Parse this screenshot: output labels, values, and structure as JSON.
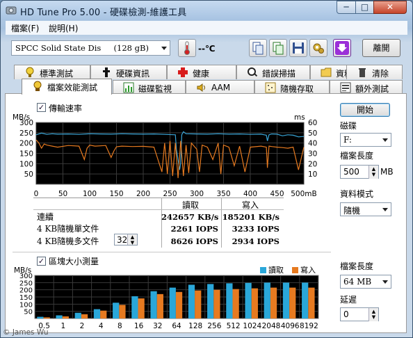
{
  "window": {
    "title": "HD Tune Pro  5.00 - 硬碟檢測-維護工具",
    "minimize": "─",
    "maximize": "□",
    "close": "✕"
  },
  "menu": {
    "items": [
      "檔案(F)",
      "說明(H)"
    ]
  },
  "toolbar": {
    "drive_select": "SPCC Solid State Dis     (128 gB)",
    "temperature": "--℃",
    "exit_label": "離開",
    "accent_purple": "#9b2fd8"
  },
  "tabs_row1": [
    {
      "label": "標準測試",
      "icon": "benchmark-icon"
    },
    {
      "label": "硬碟資訊",
      "icon": "info-icon"
    },
    {
      "label": "健康",
      "icon": "health-cross-icon"
    },
    {
      "label": "錯誤掃描",
      "icon": "error-scan-icon"
    },
    {
      "label": "資料夾使用率",
      "icon": "folder-icon"
    },
    {
      "label": "清除",
      "icon": "trash-icon"
    }
  ],
  "tabs_row2": [
    {
      "label": "檔案效能測試",
      "icon": "file-benchmark-icon",
      "active": true
    },
    {
      "label": "磁碟監視",
      "icon": "disk-monitor-icon"
    },
    {
      "label": "AAM",
      "icon": "speaker-icon"
    },
    {
      "label": "隨機存取",
      "icon": "random-access-icon"
    },
    {
      "label": "額外測試",
      "icon": "extra-tests-icon"
    }
  ],
  "transfer": {
    "checkbox_label": "傳輸速率",
    "checked": true,
    "headers": {
      "read": "讀取",
      "write": "寫入"
    },
    "rows": [
      {
        "label": "連續",
        "read": "242657 KB/s",
        "write": "185201 KB/s"
      },
      {
        "label": "4 KB隨機單文件",
        "read": "2261 IOPS",
        "write": "3233 IOPS"
      },
      {
        "label": "4 KB隨機多文件",
        "read": "8626 IOPS",
        "write": "2934 IOPS"
      }
    ],
    "queue_depth": "32"
  },
  "chart_data": [
    {
      "type": "line",
      "title": "",
      "xlabel": "",
      "ylabel": "MB/s",
      "y2label": "ms",
      "x_unit": "mB",
      "xlim": [
        0,
        500
      ],
      "ylim": [
        0,
        300
      ],
      "y2lim": [
        0,
        60
      ],
      "x_ticks": [
        "0",
        "50",
        "100",
        "150",
        "200",
        "250",
        "300",
        "350",
        "400",
        "450",
        "500mB"
      ],
      "y_ticks": [
        "300",
        "250",
        "200",
        "150",
        "100",
        "50"
      ],
      "y2_ticks": [
        "60",
        "50",
        "40",
        "30",
        "20",
        "10"
      ],
      "grid": true,
      "background": "#000000",
      "series": [
        {
          "color": "#3aa6d8",
          "x": [
            0,
            10,
            20,
            30,
            40,
            60,
            80,
            100,
            120,
            140,
            160,
            180,
            200,
            220,
            240,
            260,
            262,
            265,
            268,
            270,
            272,
            275,
            280,
            300,
            320,
            340,
            360,
            380,
            400,
            420,
            430,
            432,
            435,
            440,
            450,
            460,
            470,
            480,
            490,
            500
          ],
          "y": [
            240,
            248,
            242,
            245,
            243,
            244,
            242,
            245,
            244,
            243,
            245,
            244,
            243,
            244,
            242,
            240,
            170,
            120,
            70,
            105,
            240,
            255,
            245,
            244,
            243,
            245,
            243,
            244,
            242,
            243,
            238,
            210,
            240,
            244,
            243,
            235,
            240,
            238,
            230,
            232
          ]
        },
        {
          "color": "#e67a20",
          "x": [
            0,
            5,
            10,
            15,
            20,
            30,
            40,
            60,
            80,
            90,
            95,
            100,
            110,
            130,
            140,
            145,
            150,
            160,
            180,
            200,
            220,
            235,
            240,
            245,
            250,
            255,
            260,
            265,
            270,
            275,
            280,
            285,
            290,
            300,
            305,
            310,
            320,
            330,
            340,
            345,
            350,
            360,
            370,
            380,
            390,
            400,
            420,
            430,
            432,
            435,
            440,
            450,
            460,
            470,
            480,
            490,
            500
          ],
          "y": [
            215,
            200,
            175,
            195,
            190,
            185,
            180,
            188,
            185,
            120,
            175,
            190,
            185,
            188,
            130,
            160,
            182,
            185,
            183,
            184,
            180,
            60,
            200,
            50,
            210,
            40,
            200,
            30,
            210,
            40,
            190,
            55,
            200,
            170,
            60,
            190,
            180,
            120,
            200,
            50,
            190,
            180,
            90,
            185,
            60,
            180,
            185,
            180,
            80,
            185,
            183,
            180,
            178,
            175,
            180,
            70,
            180
          ]
        }
      ]
    },
    {
      "type": "bar",
      "title": "",
      "ylabel": "MB/s",
      "categories": [
        "0.5",
        "1",
        "2",
        "4",
        "8",
        "16",
        "32",
        "64",
        "128",
        "256",
        "512",
        "1024",
        "2048",
        "4096",
        "8192"
      ],
      "ylim": [
        0,
        300
      ],
      "y_ticks": [
        "300",
        "250",
        "200",
        "150",
        "100",
        "50"
      ],
      "grid": true,
      "background": "#000000",
      "legend_position": "top-right",
      "series": [
        {
          "name": "讀取",
          "color": "#2aa7d9",
          "values": [
            12,
            22,
            40,
            65,
            110,
            155,
            190,
            215,
            235,
            240,
            245,
            248,
            250,
            250,
            250
          ]
        },
        {
          "name": "寫入",
          "color": "#e67a20",
          "values": [
            8,
            15,
            30,
            55,
            95,
            140,
            170,
            185,
            195,
            200,
            205,
            210,
            215,
            215,
            215
          ]
        }
      ]
    }
  ],
  "block": {
    "checkbox_label": "區塊大小測量",
    "checked": true
  },
  "right_panel": {
    "start_label": "開始",
    "disk_label": "磁碟",
    "disk_value": "F:",
    "file_len_label": "檔案長度",
    "file_len_value": "500",
    "file_len_unit": "MB",
    "data_mode_label": "資料模式",
    "data_mode_value": "隨機",
    "file_len2_label": "檔案長度",
    "file_len2_value": "64 MB",
    "delay_label": "延遲",
    "delay_value": "0"
  },
  "footer": {
    "copyright": "© James Wu"
  }
}
